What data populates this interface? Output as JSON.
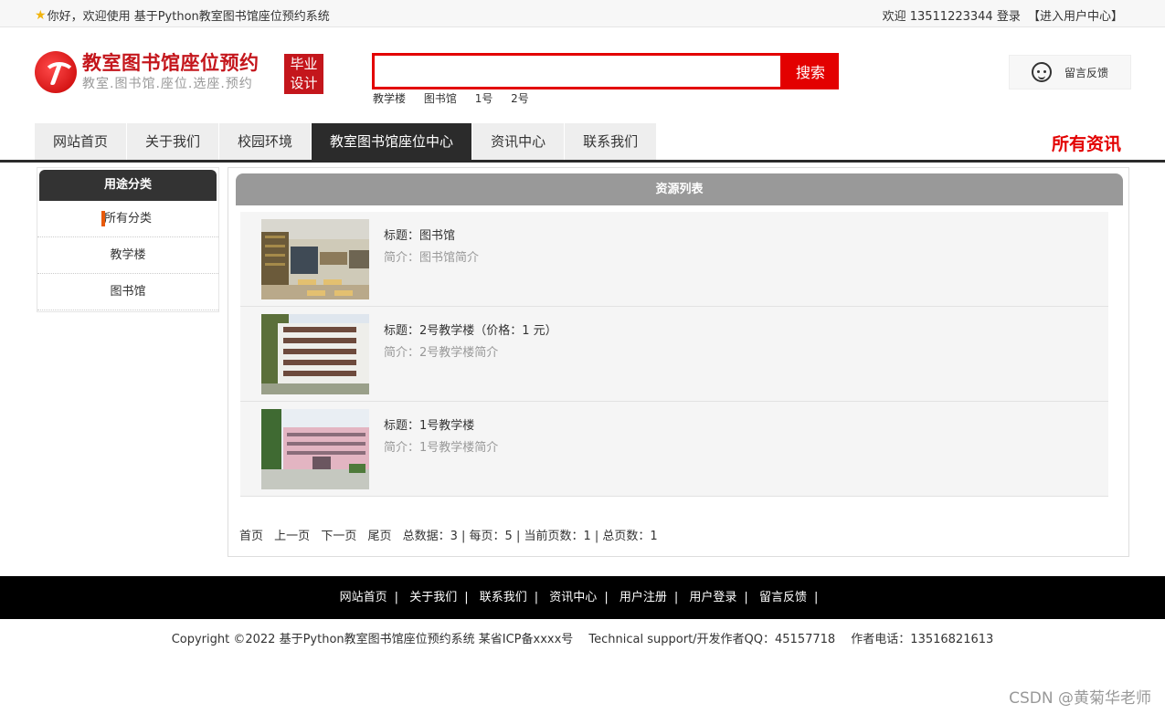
{
  "topbar": {
    "welcome": "你好，欢迎使用 基于Python教室图书馆座位预约系统",
    "greeting": "欢迎 13511223344 登录",
    "user_center": "【进入用户中心】"
  },
  "header": {
    "logo_title": "教室图书馆座位预约",
    "logo_sub": "教室.图书馆.座位.选座.预约",
    "badge_line1": "毕业",
    "badge_line2": "设计",
    "search_value": "",
    "search_button": "搜索",
    "hotwords": [
      "教学楼",
      "图书馆",
      "1号",
      "2号"
    ],
    "feedback": "留言反馈"
  },
  "nav": {
    "items": [
      "网站首页",
      "关于我们",
      "校园环境",
      "教室图书馆座位中心",
      "资讯中心",
      "联系我们"
    ],
    "active_index": 3,
    "right_title": "所有资讯"
  },
  "sidebar": {
    "title": "用途分类",
    "items": [
      "所有分类",
      "教学楼",
      "图书馆"
    ]
  },
  "main": {
    "title": "资源列表",
    "items": [
      {
        "title": "标题：图书馆",
        "desc": "简介：图书馆简介"
      },
      {
        "title": "标题：2号教学楼（价格：1 元）",
        "desc": "简介：2号教学楼简介"
      },
      {
        "title": "标题：1号教学楼",
        "desc": "简介：1号教学楼简介"
      }
    ],
    "pager": {
      "first": "首页",
      "prev": "上一页",
      "next": "下一页",
      "last": "尾页",
      "stats": "总数据：3 | 每页：5 | 当前页数：1 | 总页数：1"
    }
  },
  "footer": {
    "links": [
      "网站首页",
      "关于我们",
      "联系我们",
      "资讯中心",
      "用户注册",
      "用户登录",
      "留言反馈"
    ],
    "separator": "|",
    "copyright": "Copyright ©2022 基于Python教室图书馆座位预约系统 某省ICP备xxxx号　 Technical support/开发作者QQ：45157718　  作者电话：13516821613"
  },
  "watermark": "CSDN @黄菊华老师",
  "colors": {
    "brand_red": "#c4161c",
    "search_red": "#e30000",
    "nav_dark": "#2b2b2b",
    "sidebar_marker": "#e85a0a"
  }
}
